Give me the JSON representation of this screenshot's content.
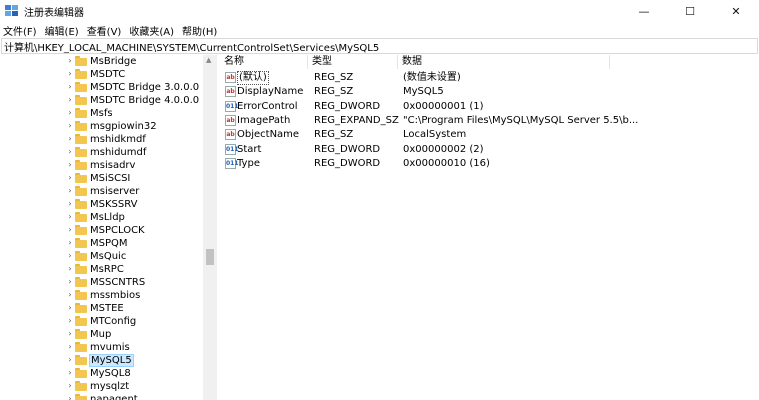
{
  "window": {
    "title": "注册表编辑器",
    "minimize_glyph": "—",
    "maximize_glyph": "☐",
    "close_glyph": "✕"
  },
  "menu": [
    "文件(F)",
    "编辑(E)",
    "查看(V)",
    "收藏夹(A)",
    "帮助(H)"
  ],
  "address": "计算机\\HKEY_LOCAL_MACHINE\\SYSTEM\\CurrentControlSet\\Services\\MySQL5",
  "tree": {
    "items": [
      {
        "label": "MsBridge"
      },
      {
        "label": "MSDTC"
      },
      {
        "label": "MSDTC Bridge 3.0.0.0"
      },
      {
        "label": "MSDTC Bridge 4.0.0.0"
      },
      {
        "label": "Msfs"
      },
      {
        "label": "msgpiowin32"
      },
      {
        "label": "mshidkmdf"
      },
      {
        "label": "mshidumdf"
      },
      {
        "label": "msisadrv"
      },
      {
        "label": "MSiSCSI"
      },
      {
        "label": "msiserver"
      },
      {
        "label": "MSKSSRV"
      },
      {
        "label": "MsLldp"
      },
      {
        "label": "MSPCLOCK"
      },
      {
        "label": "MSPQM"
      },
      {
        "label": "MsQuic"
      },
      {
        "label": "MsRPC"
      },
      {
        "label": "MSSCNTRS"
      },
      {
        "label": "mssmbios"
      },
      {
        "label": "MSTEE"
      },
      {
        "label": "MTConfig"
      },
      {
        "label": "Mup"
      },
      {
        "label": "mvumis"
      },
      {
        "label": "MySQL5",
        "selected": true
      },
      {
        "label": "MySQL8"
      },
      {
        "label": "mysqlzt"
      },
      {
        "label": "napagent"
      }
    ],
    "expand_glyph": "›"
  },
  "list": {
    "headers": {
      "name": "名称",
      "type": "类型",
      "data": "数据"
    },
    "rows": [
      {
        "icon": "string-value-icon",
        "icon_text": "ab",
        "name": "(默认)",
        "type": "REG_SZ",
        "data": "(数值未设置)"
      },
      {
        "icon": "string-value-icon",
        "icon_text": "ab",
        "name": "DisplayName",
        "type": "REG_SZ",
        "data": "MySQL5"
      },
      {
        "icon": "dword-value-icon",
        "icon_text": "011",
        "name": "ErrorControl",
        "type": "REG_DWORD",
        "data": "0x00000001 (1)"
      },
      {
        "icon": "string-value-icon",
        "icon_text": "ab",
        "name": "ImagePath",
        "type": "REG_EXPAND_SZ",
        "data": "\"C:\\Program Files\\MySQL\\MySQL Server 5.5\\b..."
      },
      {
        "icon": "string-value-icon",
        "icon_text": "ab",
        "name": "ObjectName",
        "type": "REG_SZ",
        "data": "LocalSystem"
      },
      {
        "icon": "dword-value-icon",
        "icon_text": "011",
        "name": "Start",
        "type": "REG_DWORD",
        "data": "0x00000002 (2)"
      },
      {
        "icon": "dword-value-icon",
        "icon_text": "011",
        "name": "Type",
        "type": "REG_DWORD",
        "data": "0x00000010 (16)"
      }
    ]
  },
  "colors": {
    "folder": "#f3c64f",
    "selection": "#cce8ff"
  }
}
